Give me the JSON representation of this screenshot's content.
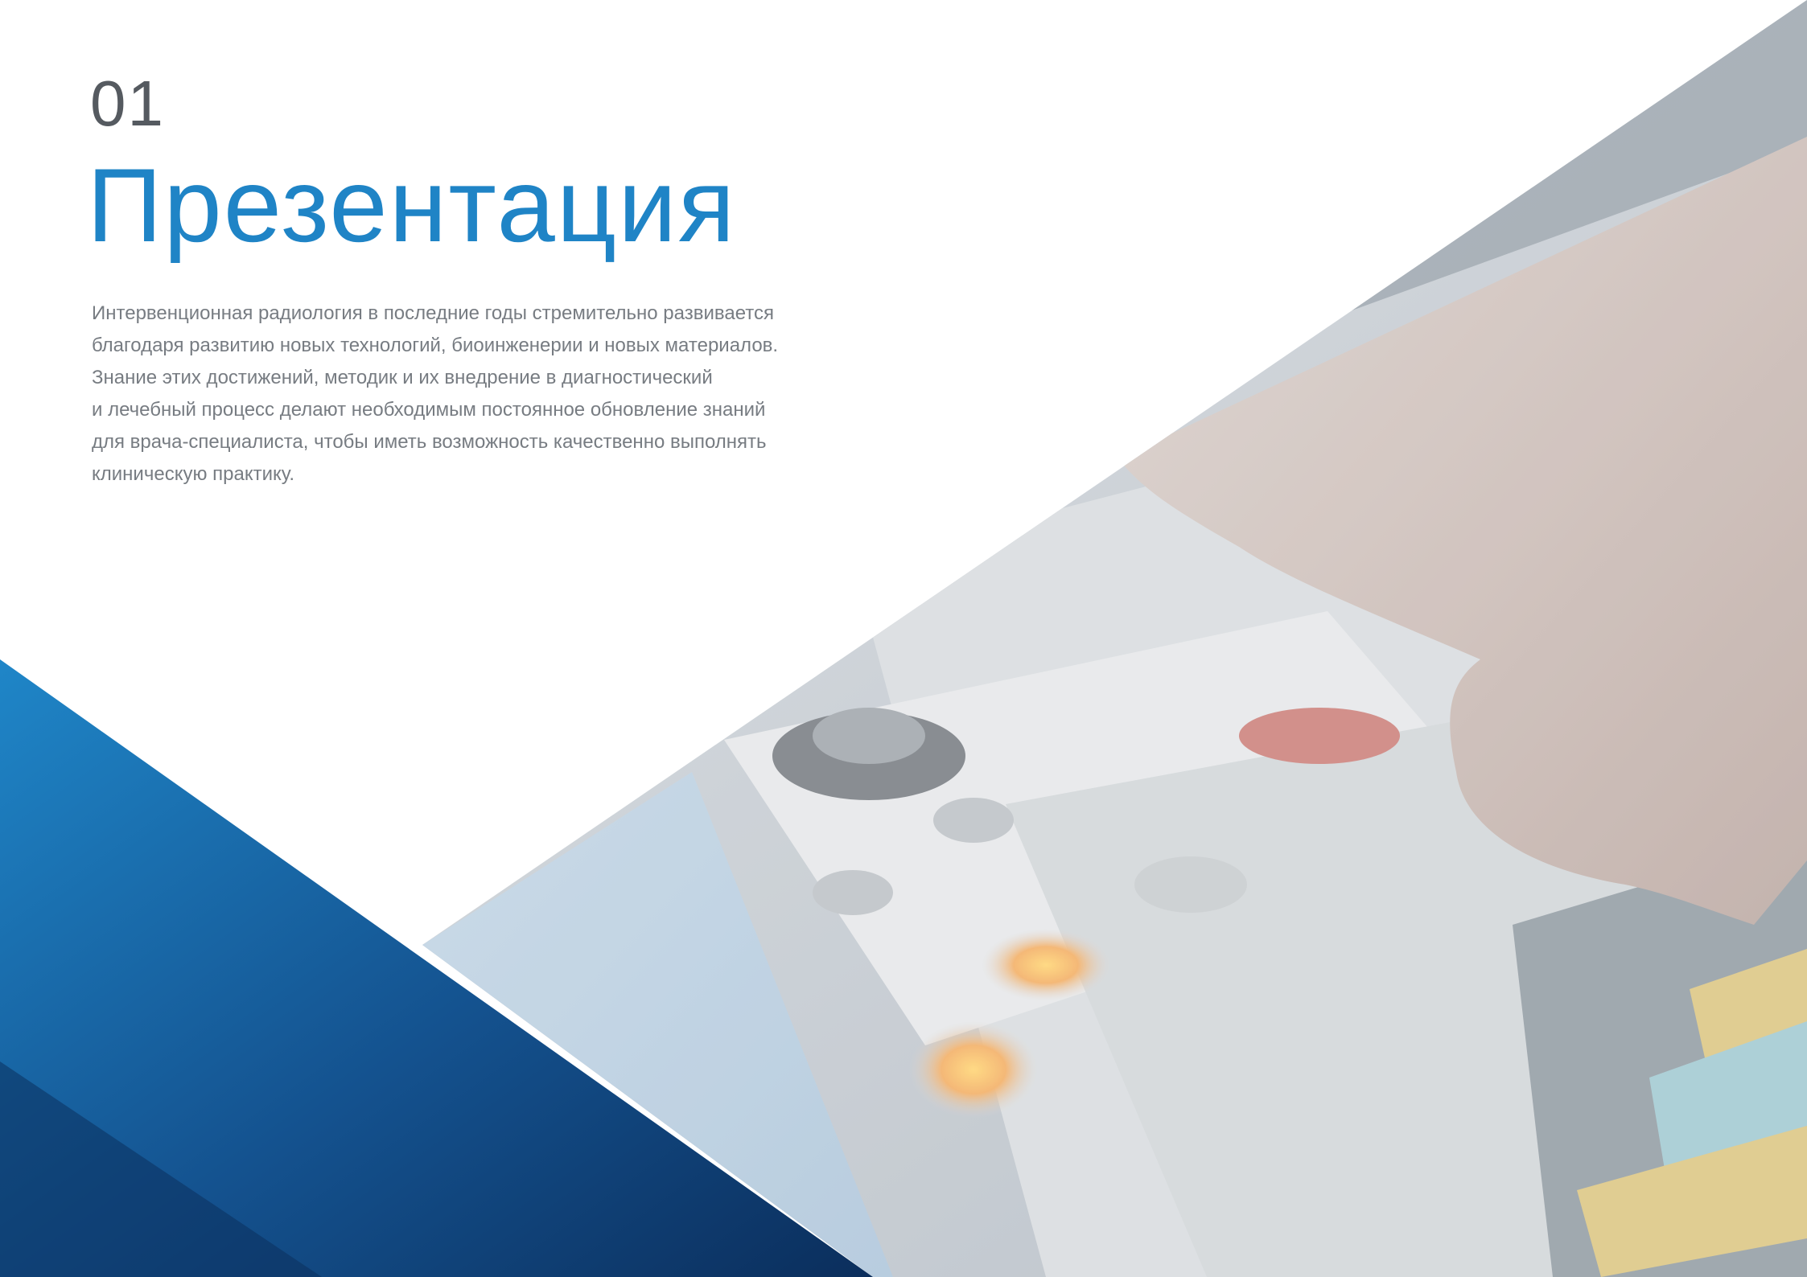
{
  "section": {
    "number": "01",
    "title": "Презентация"
  },
  "intro": {
    "lines": [
      "Интервенционная радиология в последние годы стремительно развивается",
      "благодаря развитию новых технологий, биоинженерии и новых материалов.",
      "Знание этих достижений, методик и их внедрение в диагностический",
      "и лечебный процесс делают необходимым постоянное обновление знаний",
      "для врача-специалиста, чтобы иметь возможность качественно выполнять",
      "клиническую практику."
    ]
  },
  "colors": {
    "accent_blue": "#1f84c6",
    "dark_blue": "#0e3f78",
    "navy": "#0a2a52",
    "number_gray": "#555a60",
    "body_gray": "#777c82"
  },
  "photo": {
    "description_icon": "control-panel-photo"
  }
}
